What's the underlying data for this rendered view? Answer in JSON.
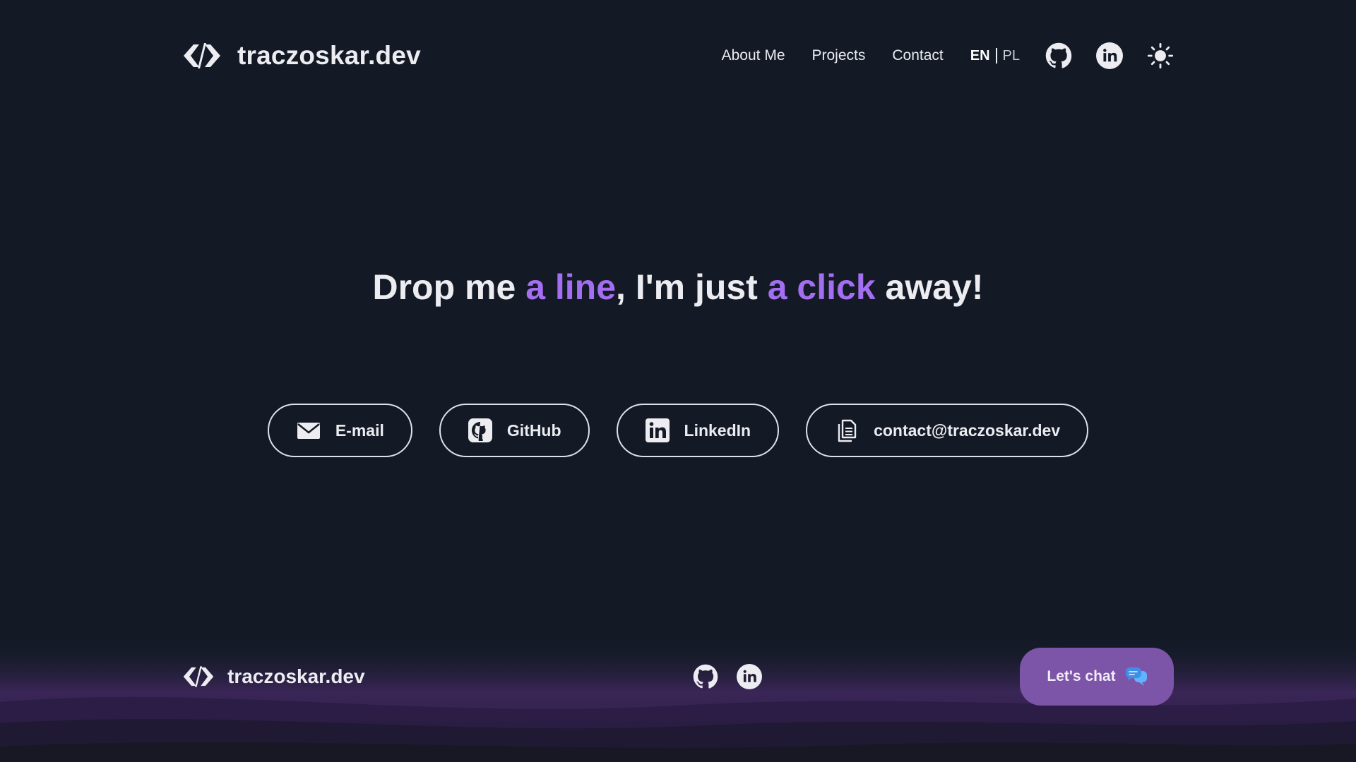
{
  "header": {
    "brand": "traczoskar.dev",
    "logo_icon": "code-brackets-icon",
    "nav": [
      "About Me",
      "Projects",
      "Contact"
    ],
    "lang_active": "EN",
    "lang_inactive": "PL",
    "icons": [
      "github-icon",
      "linkedin-icon",
      "sun-icon"
    ]
  },
  "hero": {
    "part1": "Drop me ",
    "accent1": "a line",
    "part2": ", I'm just ",
    "accent2": "a click",
    "part3": " away!"
  },
  "contacts": [
    {
      "label": "E-mail",
      "icon": "envelope-icon"
    },
    {
      "label": "GitHub",
      "icon": "github-icon"
    },
    {
      "label": "LinkedIn",
      "icon": "linkedin-icon"
    },
    {
      "label": "contact@traczoskar.dev",
      "icon": "copy-icon"
    }
  ],
  "footer": {
    "brand": "traczoskar.dev",
    "icons": [
      "github-icon",
      "linkedin-icon"
    ],
    "chat_label": "Let's chat",
    "chat_icon": "chat-bubbles-icon"
  },
  "colors": {
    "background": "#131a26",
    "accent": "#a46ef0",
    "chat_button": "#7d55a8",
    "text": "#ececf1"
  }
}
